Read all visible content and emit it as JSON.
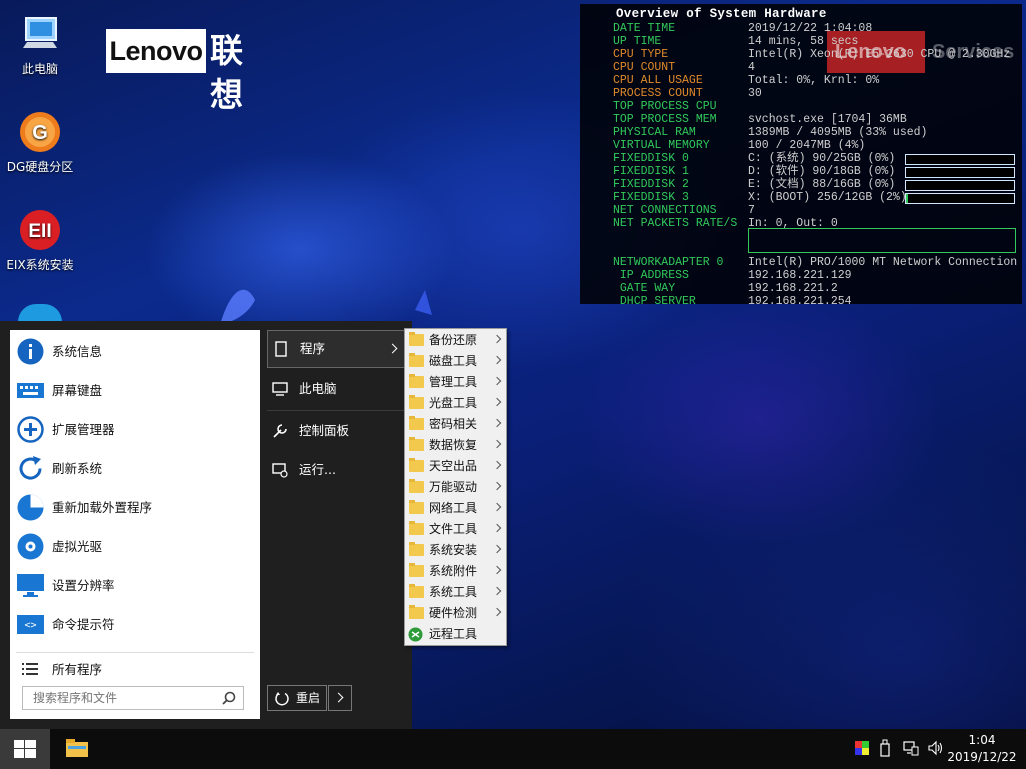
{
  "desktop": {
    "icons": [
      {
        "label": "此电脑",
        "icon": "computer-icon"
      },
      {
        "label": "DG硬盘分区",
        "icon": "dg-partition-icon"
      },
      {
        "label": "EIX系统安装",
        "icon": "eix-install-icon"
      }
    ],
    "logo": {
      "brand": "Lenovo",
      "brand_cn": "联想"
    }
  },
  "monitor": {
    "title": "Overview of System Hardware",
    "rows": [
      {
        "key": "DATE TIME",
        "value": "2019/12/22 1:04:08",
        "color": "green"
      },
      {
        "key": "UP TIME",
        "value": "14 mins, 58 secs",
        "color": "green"
      },
      {
        "key": "CPU TYPE",
        "value": "Intel(R) Xeon(R) E5-2630 CPU @ 2.30GHz",
        "color": "orange"
      },
      {
        "key": "CPU COUNT",
        "value": "4",
        "color": "orange"
      },
      {
        "key": "CPU ALL USAGE",
        "value": "Total: 0%, Krnl: 0%",
        "color": "orange"
      },
      {
        "key": "PROCESS COUNT",
        "value": "30",
        "color": "orange"
      },
      {
        "key": "TOP PROCESS CPU",
        "value": "",
        "color": "green"
      },
      {
        "key": "TOP PROCESS MEM",
        "value": "svchost.exe [1704] 36MB",
        "color": "green"
      },
      {
        "key": "PHYSICAL RAM",
        "value": "1389MB / 4095MB (33% used)",
        "color": "green"
      },
      {
        "key": "VIRTUAL MEMORY",
        "value": "100 / 2047MB (4%)",
        "color": "green"
      },
      {
        "key": "FIXEDDISK 0",
        "value": "C: (系统) 90/25GB (0%)",
        "color": "green",
        "usage": 0
      },
      {
        "key": "FIXEDDISK 1",
        "value": "D: (软件) 90/18GB (0%)",
        "color": "green",
        "usage": 0
      },
      {
        "key": "FIXEDDISK 2",
        "value": "E: (文档) 88/16GB (0%)",
        "color": "green",
        "usage": 0
      },
      {
        "key": "FIXEDDISK 3",
        "value": "X: (BOOT) 256/12GB (2%)",
        "color": "green",
        "usage": 2
      },
      {
        "key": "NET CONNECTIONS",
        "value": "7",
        "color": "green"
      },
      {
        "key": "NET PACKETS RATE/S",
        "value": "In: 0, Out: 0",
        "color": "green"
      }
    ],
    "adapter_rows": [
      {
        "key": "NETWORKADAPTER 0",
        "value": "Intel(R) PRO/1000 MT Network Connection"
      },
      {
        "key": " IP ADDRESS",
        "value": "192.168.221.129"
      },
      {
        "key": " GATE WAY",
        "value": "192.168.221.2"
      },
      {
        "key": " DHCP SERVER",
        "value": "192.168.221.254"
      }
    ],
    "watermark": {
      "brand": "Lenovo",
      "service": "Services"
    }
  },
  "start_menu": {
    "left_items": [
      {
        "label": "系统信息",
        "icon": "info-icon"
      },
      {
        "label": "屏幕键盘",
        "icon": "keyboard-icon"
      },
      {
        "label": "扩展管理器",
        "icon": "plus-circle-icon"
      },
      {
        "label": "刷新系统",
        "icon": "refresh-icon"
      },
      {
        "label": "重新加载外置程序",
        "icon": "pie-icon"
      },
      {
        "label": "虚拟光驱",
        "icon": "disc-icon"
      },
      {
        "label": "设置分辨率",
        "icon": "monitor-icon"
      },
      {
        "label": "命令提示符",
        "icon": "cmd-icon"
      }
    ],
    "all_programs": "所有程序",
    "search_placeholder": "搜索程序和文件",
    "right_items": [
      {
        "label": "程序",
        "icon": "programs-icon"
      },
      {
        "label": "此电脑",
        "icon": "computer-icon"
      },
      {
        "label": "控制面板",
        "icon": "wrench-icon"
      },
      {
        "label": "运行...",
        "icon": "run-icon"
      }
    ],
    "restart_label": "重启"
  },
  "submenu": {
    "items": [
      {
        "label": "备份还原",
        "arrow": true
      },
      {
        "label": "磁盘工具",
        "arrow": true
      },
      {
        "label": "管理工具",
        "arrow": true
      },
      {
        "label": "光盘工具",
        "arrow": true
      },
      {
        "label": "密码相关",
        "arrow": true
      },
      {
        "label": "数据恢复",
        "arrow": true
      },
      {
        "label": "天空出品",
        "arrow": true
      },
      {
        "label": "万能驱动",
        "arrow": true
      },
      {
        "label": "网络工具",
        "arrow": true
      },
      {
        "label": "文件工具",
        "arrow": true
      },
      {
        "label": "系统安装",
        "arrow": true
      },
      {
        "label": "系统附件",
        "arrow": true
      },
      {
        "label": "系统工具",
        "arrow": true
      },
      {
        "label": "硬件检测",
        "arrow": true
      },
      {
        "label": "远程工具",
        "arrow": false
      }
    ]
  },
  "taskbar": {
    "time": "1:04",
    "date": "2019/12/22"
  }
}
